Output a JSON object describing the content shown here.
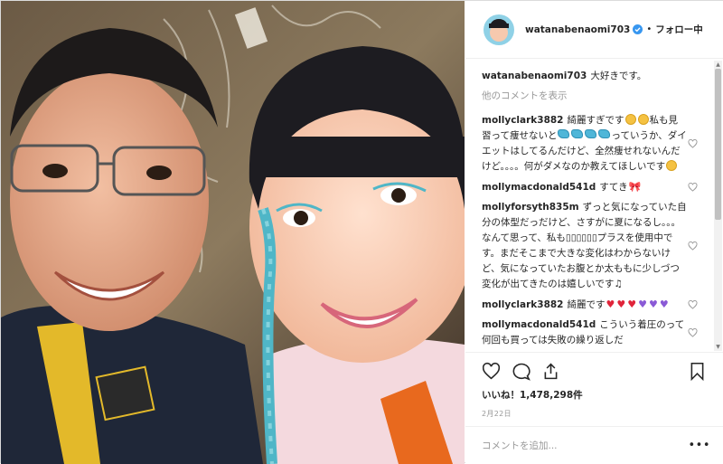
{
  "post": {
    "username": "watanabenaomi703",
    "follow_separator": "•",
    "follow_label": "フォロー中",
    "caption_user": "watanabenaomi703",
    "caption_text": "大好きです。",
    "more_comments": "他のコメントを表示",
    "likes_text": "いいね！1,478,298件",
    "date_text": "2月22日",
    "add_comment_placeholder": "コメントを追加...",
    "options_label": "•••"
  },
  "comments": [
    {
      "user": "mollyclark3882",
      "parts": [
        "綺麗すぎです",
        "[smile]",
        "[smile]",
        "私も見習って痩せないと",
        "[blue]",
        "[blue]",
        "[blue]",
        "[blue]",
        "っていうか、ダイエットはしてるんだけど、全然痩せれないんだけど。。。。何がダメなのか教えてほしいです",
        "[sad]"
      ]
    },
    {
      "user": "mollymacdonald541d",
      "parts": [
        "すてき",
        "[bow]"
      ]
    },
    {
      "user": "mollyforsyth835m",
      "parts": [
        "ずっと気になっていた自分の体型だっだけど、さすがに夏になるし。。。なんて思って、私も▯▯▯▯▯▯プラスを使用中です。まだそこまで大きな変化はわからないけど、気になっていたお腹とか太ももに少しづつ変化が出てきたのは嬉しいです♫"
      ]
    },
    {
      "user": "mollyclark3882",
      "parts": [
        "綺麗です",
        "[red]",
        "[red]",
        "[red]",
        "[purple]",
        "[purple]",
        "[purple]"
      ]
    },
    {
      "user": "mollymacdonald541d",
      "parts": [
        "こういう着圧のって何回も買っては失敗の繰り返しだ"
      ]
    }
  ],
  "colors": {
    "accent": "#3897f0",
    "muted": "#999999",
    "text": "#262626",
    "heart_red": "#e0243a"
  },
  "icons": [
    "verified-badge-icon",
    "heart-icon",
    "comment-icon",
    "share-icon",
    "bookmark-icon",
    "small-heart-icon"
  ],
  "scroll_fraction": 0.55
}
